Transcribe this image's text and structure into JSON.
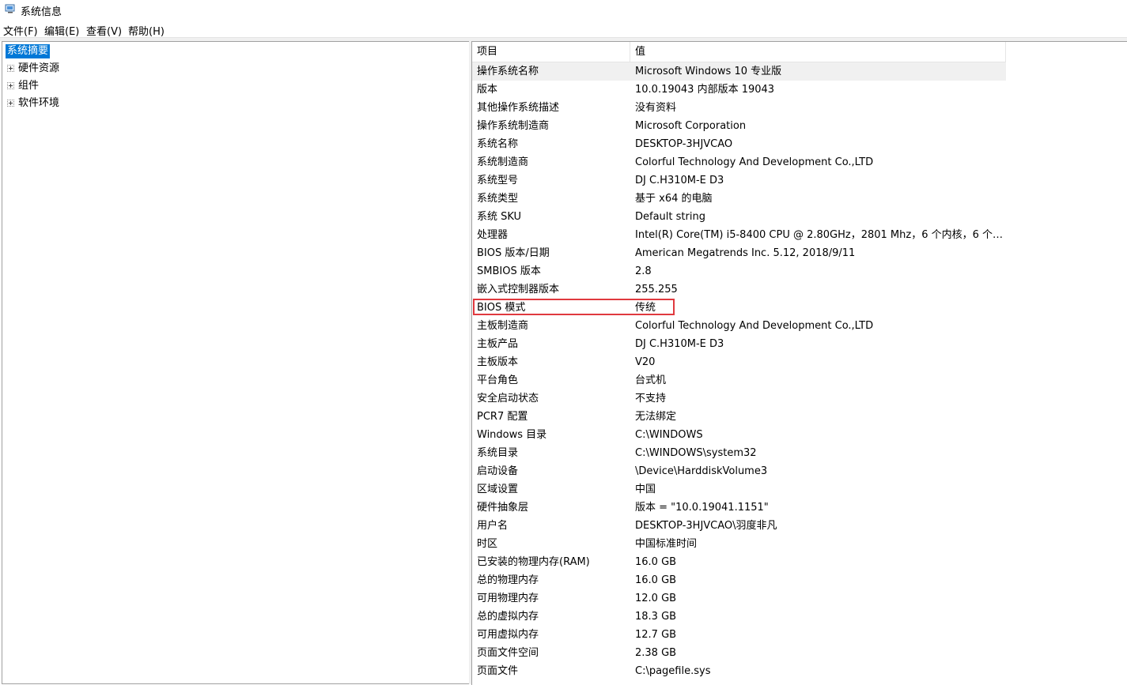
{
  "window": {
    "title": "系统信息",
    "icon": "system-info-icon"
  },
  "menu": [
    "文件(F)",
    "编辑(E)",
    "查看(V)",
    "帮助(H)"
  ],
  "tree": {
    "root": "系统摘要",
    "children": [
      "硬件资源",
      "组件",
      "软件环境"
    ]
  },
  "table": {
    "headers": [
      "项目",
      "值"
    ],
    "rows": [
      [
        "操作系统名称",
        "Microsoft Windows 10 专业版"
      ],
      [
        "版本",
        "10.0.19043 内部版本 19043"
      ],
      [
        "其他操作系统描述",
        "没有资料"
      ],
      [
        "操作系统制造商",
        "Microsoft Corporation"
      ],
      [
        "系统名称",
        "DESKTOP-3HJVCAO"
      ],
      [
        "系统制造商",
        "Colorful Technology And Development Co.,LTD"
      ],
      [
        "系统型号",
        "DJ C.H310M-E D3"
      ],
      [
        "系统类型",
        "基于 x64 的电脑"
      ],
      [
        "系统 SKU",
        "Default string"
      ],
      [
        "处理器",
        "Intel(R) Core(TM) i5-8400 CPU @ 2.80GHz，2801 Mhz，6 个内核，6 个逻..."
      ],
      [
        "BIOS 版本/日期",
        "American Megatrends Inc. 5.12, 2018/9/11"
      ],
      [
        "SMBIOS 版本",
        "2.8"
      ],
      [
        "嵌入式控制器版本",
        "255.255"
      ],
      [
        "BIOS 模式",
        "传统"
      ],
      [
        "主板制造商",
        "Colorful Technology And Development Co.,LTD"
      ],
      [
        "主板产品",
        "DJ C.H310M-E D3"
      ],
      [
        "主板版本",
        "V20"
      ],
      [
        "平台角色",
        "台式机"
      ],
      [
        "安全启动状态",
        "不支持"
      ],
      [
        "PCR7 配置",
        "无法绑定"
      ],
      [
        "Windows 目录",
        "C:\\WINDOWS"
      ],
      [
        "系统目录",
        "C:\\WINDOWS\\system32"
      ],
      [
        "启动设备",
        "\\Device\\HarddiskVolume3"
      ],
      [
        "区域设置",
        "中国"
      ],
      [
        "硬件抽象层",
        "版本 = \"10.0.19041.1151\""
      ],
      [
        "用户名",
        "DESKTOP-3HJVCAO\\羽度非凡"
      ],
      [
        "时区",
        "中国标准时间"
      ],
      [
        "已安装的物理内存(RAM)",
        "16.0 GB"
      ],
      [
        "总的物理内存",
        "16.0 GB"
      ],
      [
        "可用物理内存",
        "12.0 GB"
      ],
      [
        "总的虚拟内存",
        "18.3 GB"
      ],
      [
        "可用虚拟内存",
        "12.7 GB"
      ],
      [
        "页面文件空间",
        "2.38 GB"
      ],
      [
        "页面文件",
        "C:\\pagefile.sys"
      ]
    ],
    "selected_row": 0,
    "highlighted_row": 13
  },
  "colors": {
    "selection": "#0078d7",
    "highlight_box": "#e0393e",
    "row_selected": "#f0f0f0"
  }
}
